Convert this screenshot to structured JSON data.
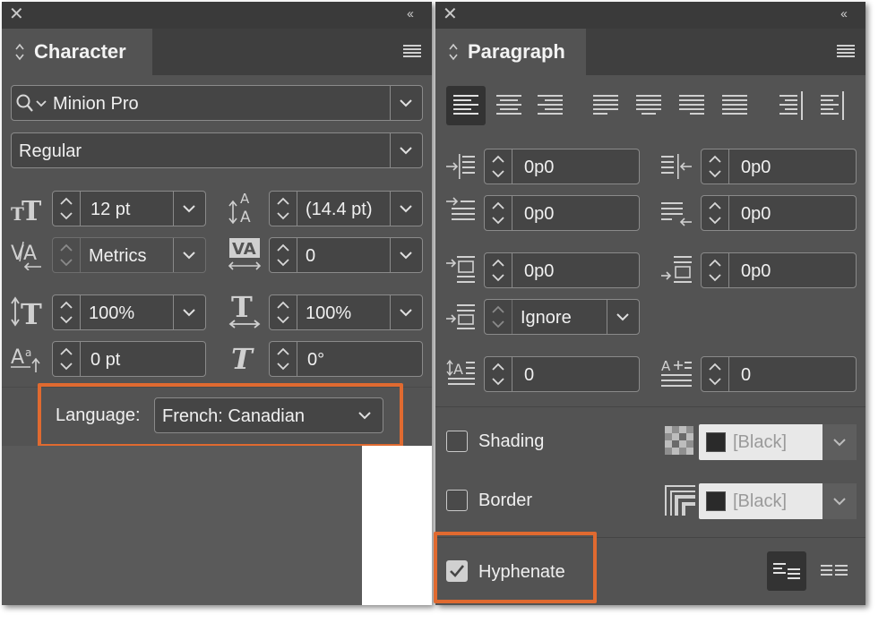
{
  "character": {
    "title": "Character",
    "font_family": "Minion Pro",
    "font_style": "Regular",
    "font_size": "12 pt",
    "leading": "(14.4 pt)",
    "kerning": "Metrics",
    "tracking": "0",
    "vertical_scale": "100%",
    "horizontal_scale": "100%",
    "baseline_shift": "0 pt",
    "skew": "0°",
    "language_label": "Language:",
    "language_value": "French: Canadian"
  },
  "paragraph": {
    "title": "Paragraph",
    "left_indent": "0p0",
    "right_indent": "0p0",
    "first_line_indent": "0p0",
    "last_line_indent": "0p0",
    "space_before": "0p0",
    "space_after": "0p0",
    "align_to_grid": "Ignore",
    "drop_cap_lines": "0",
    "drop_cap_chars": "0",
    "shading_label": "Shading",
    "shading_swatch": "[Black]",
    "border_label": "Border",
    "border_swatch": "[Black]",
    "hyphenate_label": "Hyphenate",
    "hyphenate_checked": true
  },
  "colors": {
    "panel_bg": "#535353",
    "field_bg": "#454545",
    "highlight": "#e06a30"
  }
}
